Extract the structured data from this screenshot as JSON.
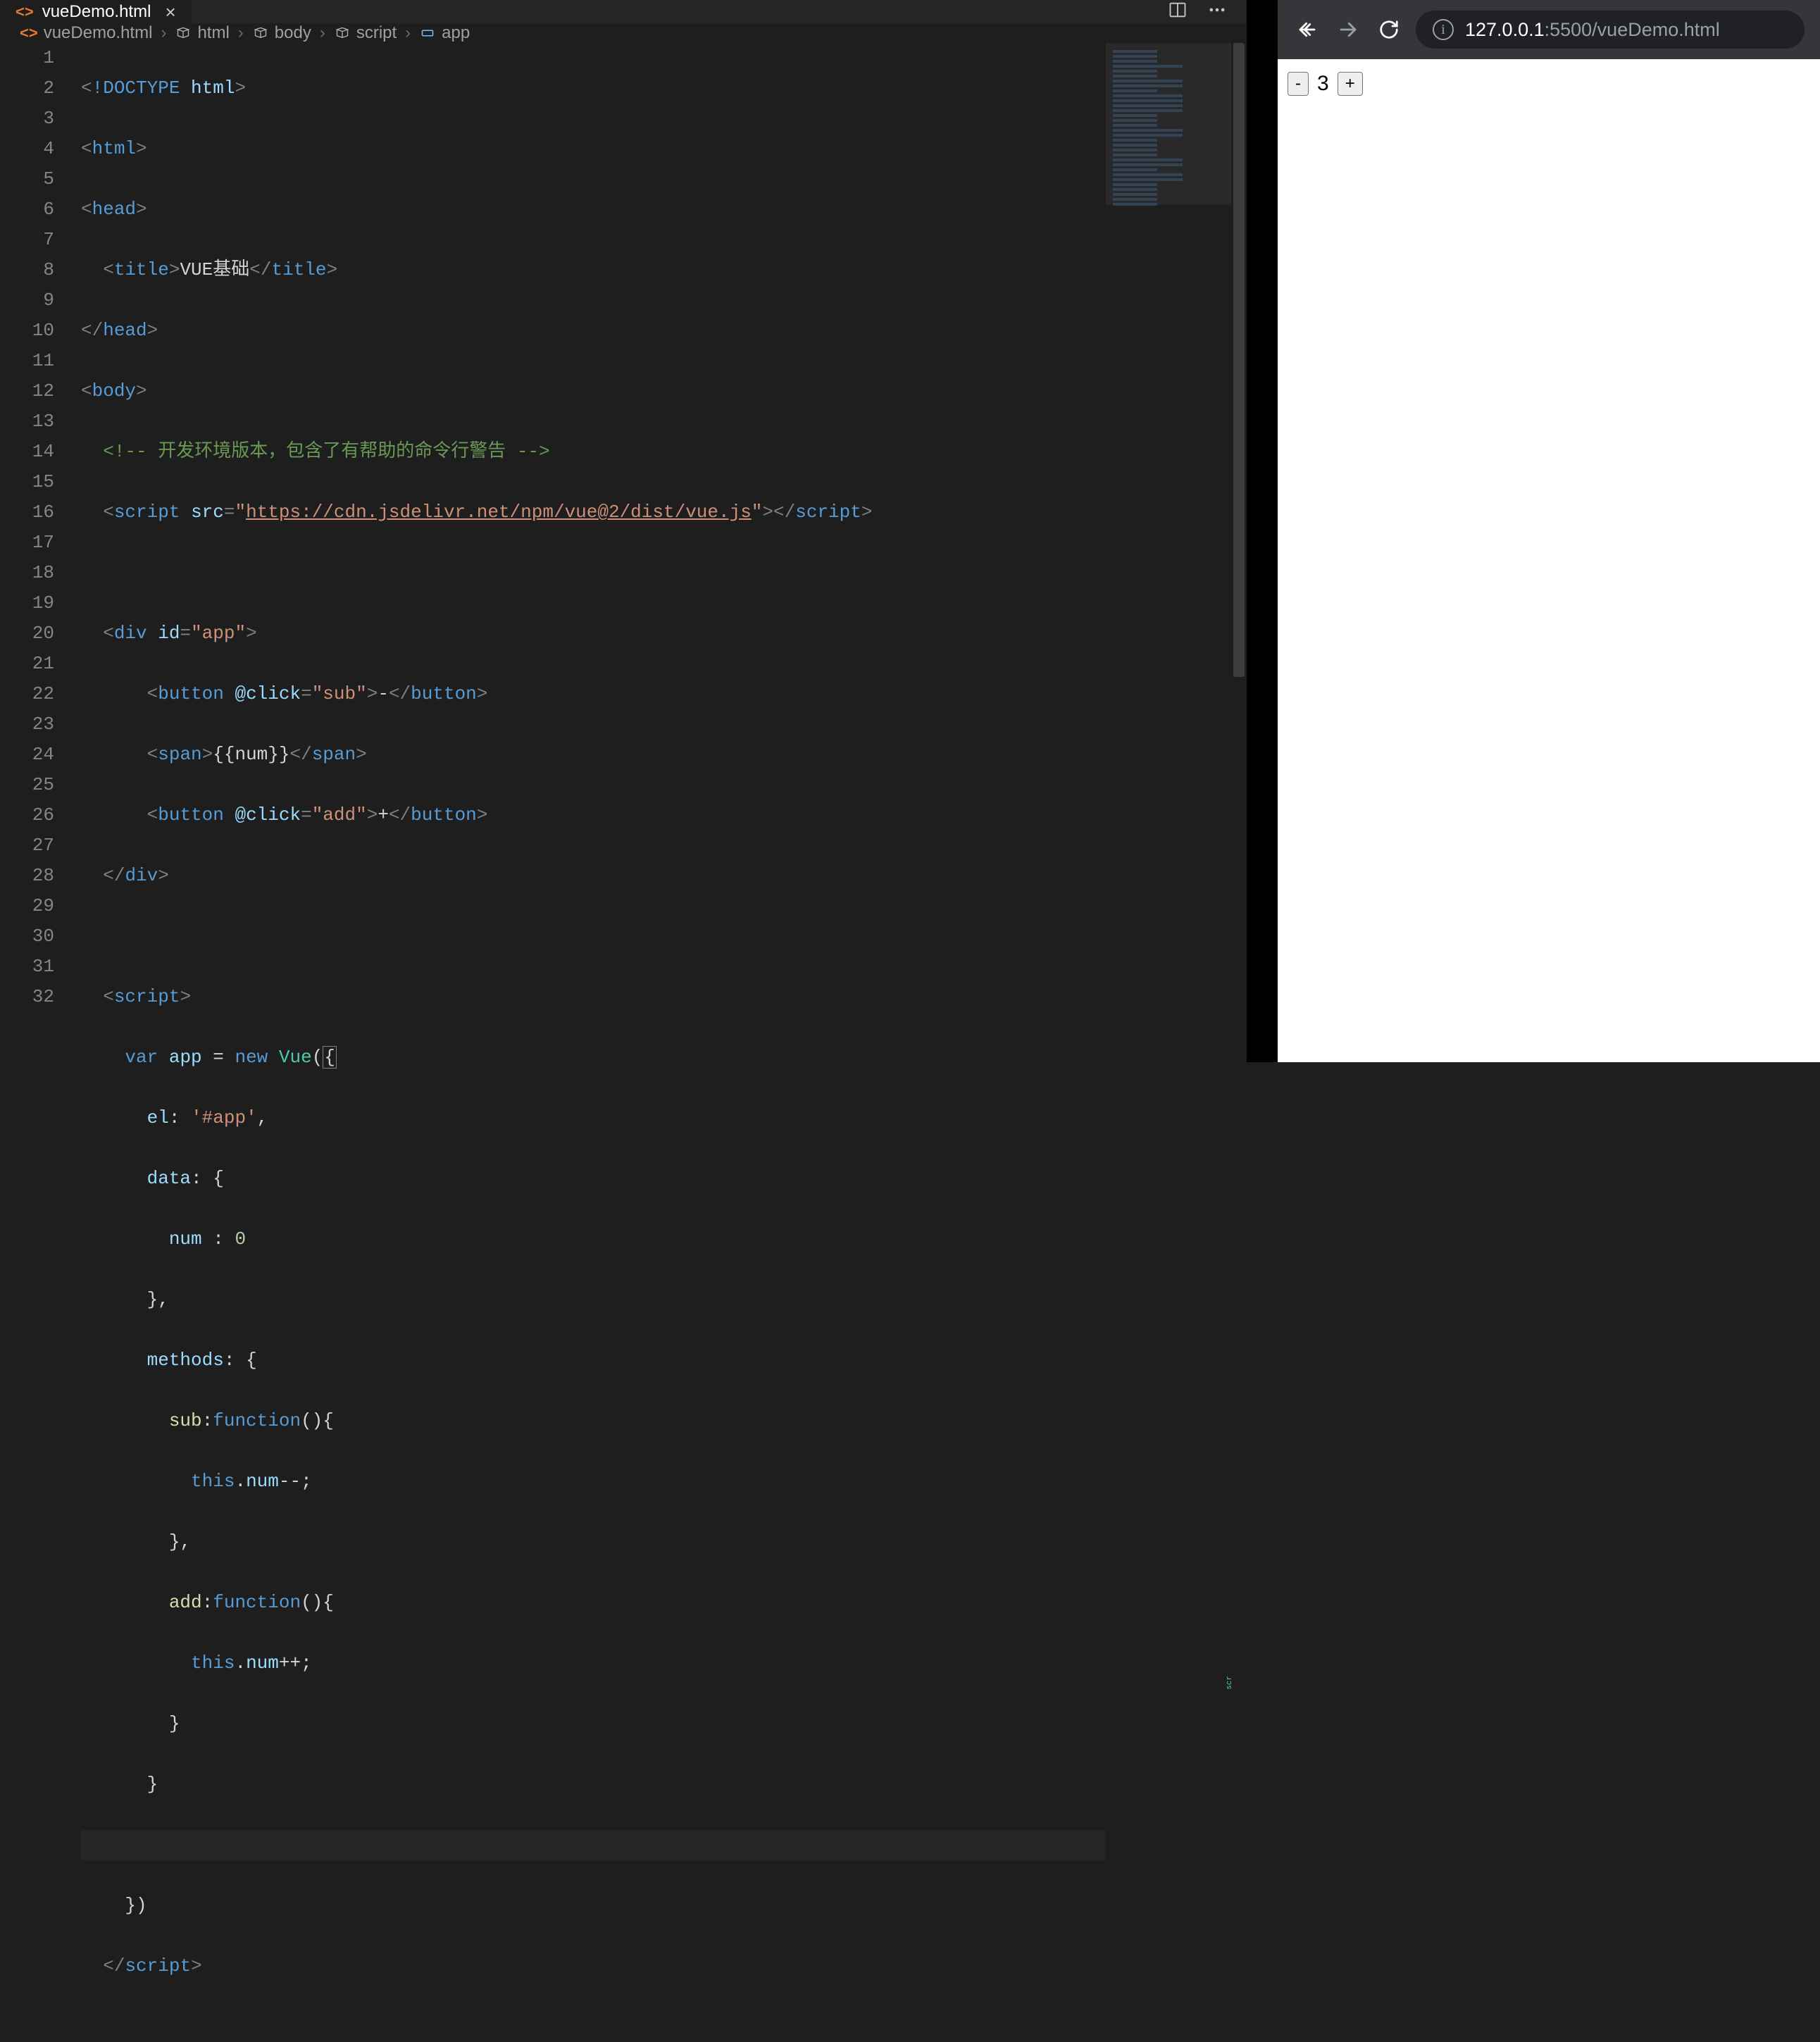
{
  "tab": {
    "filename": "vueDemo.html",
    "close_glyph": "×"
  },
  "breadcrumbs": [
    {
      "kind": "file",
      "label": "vueDemo.html"
    },
    {
      "kind": "symbol",
      "label": "html"
    },
    {
      "kind": "symbol",
      "label": "body"
    },
    {
      "kind": "symbol",
      "label": "script"
    },
    {
      "kind": "symbol",
      "label": "app"
    }
  ],
  "code": {
    "line_numbers": [
      "1",
      "2",
      "3",
      "4",
      "5",
      "6",
      "7",
      "8",
      "9",
      "10",
      "11",
      "12",
      "13",
      "14",
      "15",
      "16",
      "17",
      "18",
      "19",
      "20",
      "21",
      "22",
      "23",
      "24",
      "25",
      "26",
      "27",
      "28",
      "29",
      "30",
      "31",
      "32"
    ],
    "l1": {
      "doctype": "!DOCTYPE",
      "html": "html"
    },
    "l2": {
      "tag": "html"
    },
    "l3": {
      "tag": "head"
    },
    "l4": {
      "tag": "title",
      "text": "VUE基础",
      "closetag": "title"
    },
    "l5": {
      "closetag": "head"
    },
    "l6": {
      "tag": "body"
    },
    "l7": {
      "comment": "<!-- 开发环境版本，包含了有帮助的命令行警告 -->"
    },
    "l8": {
      "tag": "script",
      "attr": "src",
      "val": "\"",
      "url": "https://cdn.jsdelivr.net/npm/vue@2/dist/vue.js",
      "valend": "\"",
      "closetag": "script"
    },
    "l10": {
      "tag": "div",
      "attr": "id",
      "val": "\"app\""
    },
    "l11": {
      "tag": "button",
      "attr": "@click",
      "val": "\"sub\"",
      "text": "-",
      "closetag": "button"
    },
    "l12": {
      "tag": "span",
      "text": "{{num}}",
      "closetag": "span"
    },
    "l13": {
      "tag": "button",
      "attr": "@click",
      "val": "\"add\"",
      "text": "+",
      "closetag": "button"
    },
    "l14": {
      "closetag": "div"
    },
    "l16": {
      "tag": "script"
    },
    "l17": {
      "kw_var": "var",
      "name": "app",
      "eq": " = ",
      "kw_new": "new",
      "cls": "Vue",
      "paren": "(",
      "brace": "{"
    },
    "l18": {
      "prop": "el",
      "colon": ": ",
      "str": "'#app'",
      "comma": ","
    },
    "l19": {
      "prop": "data",
      "colon": ": ",
      "brace": "{"
    },
    "l20": {
      "prop": "num",
      "colon": " : ",
      "num": "0"
    },
    "l21": {
      "brace": "}",
      "comma": ","
    },
    "l22": {
      "prop": "methods",
      "colon": ": ",
      "brace": "{"
    },
    "l23": {
      "fn": "sub",
      "colon": ":",
      "kw": "function",
      "paren": "()",
      "brace": "{"
    },
    "l24": {
      "kw": "this",
      "dot": ".",
      "prop": "num",
      "op": "--;"
    },
    "l25": {
      "brace": "}",
      "comma": ","
    },
    "l26": {
      "fn": "add",
      "colon": ":",
      "kw": "function",
      "paren": "()",
      "brace": "{"
    },
    "l27": {
      "kw": "this",
      "dot": ".",
      "prop": "num",
      "op": "++;"
    },
    "l28": {
      "brace": "}"
    },
    "l29": {
      "brace": "}"
    },
    "l31": {
      "brace": "}",
      "paren": ")"
    },
    "l32": {
      "closetag": "script"
    }
  },
  "minimap_tag": "scr",
  "browser": {
    "url_host": "127.0.0.1",
    "url_path": ":5500/vueDemo.html",
    "counter": {
      "minus_label": "-",
      "value": "3",
      "plus_label": "+"
    }
  }
}
